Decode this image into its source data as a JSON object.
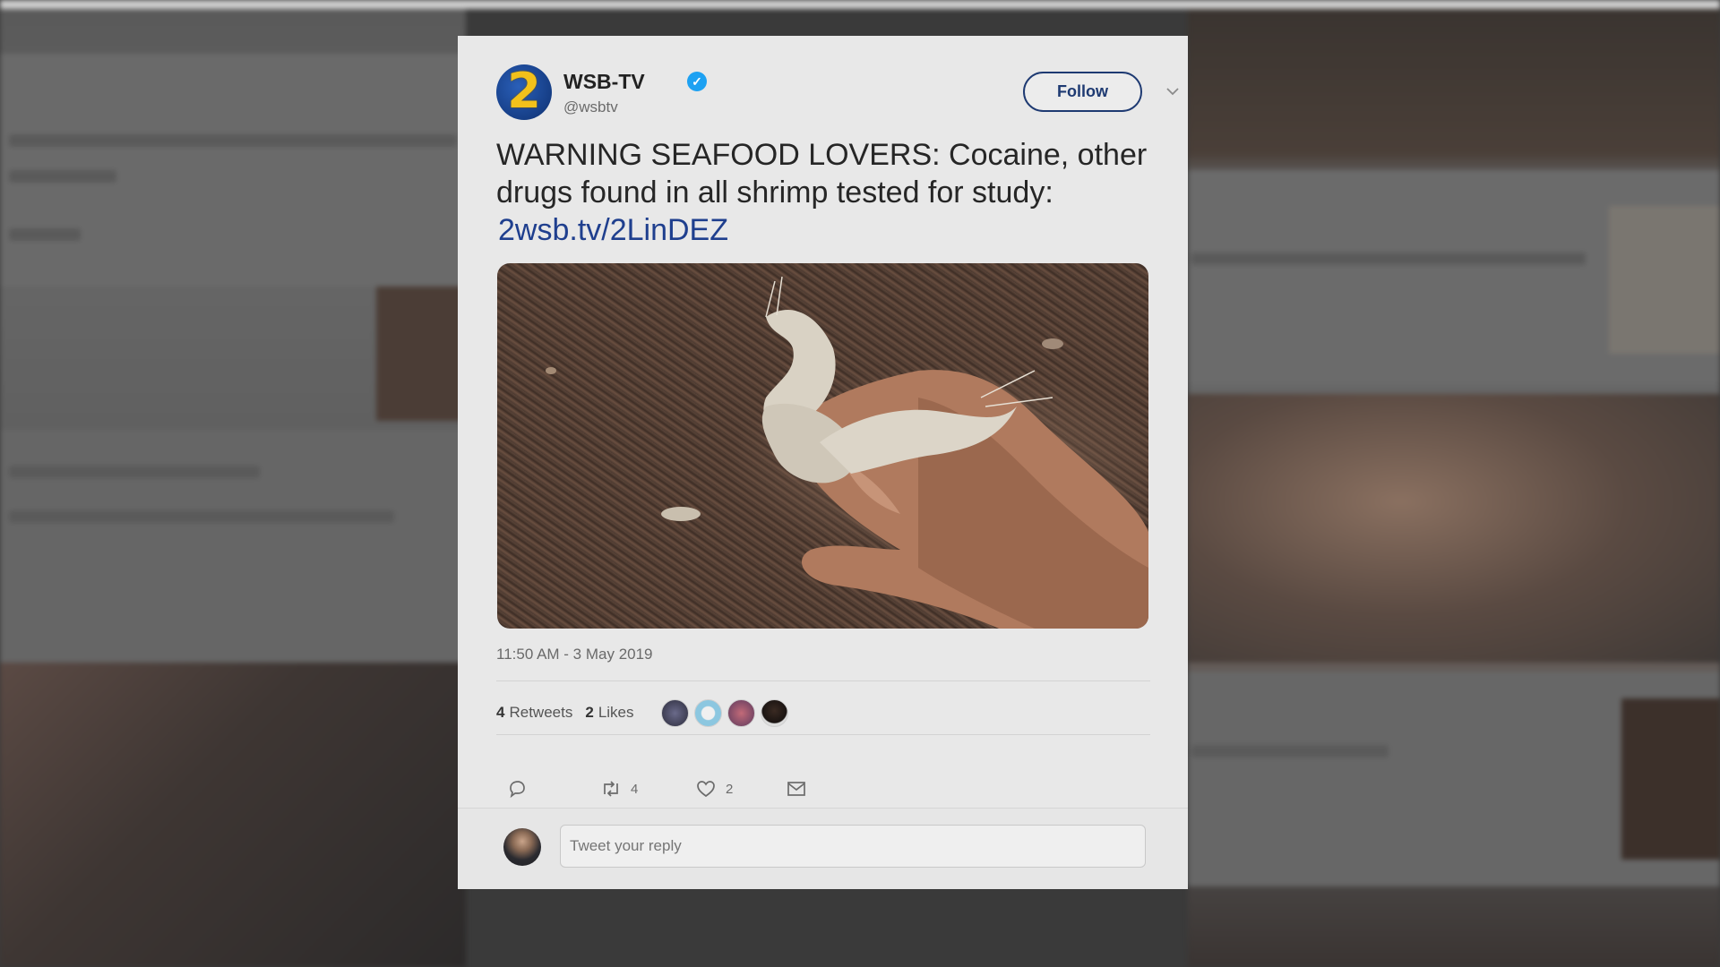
{
  "tweet": {
    "account": {
      "avatar_text": "2",
      "name": "WSB-TV",
      "verified_mark": "✓",
      "handle": "@wsbtv"
    },
    "follow_label": "Follow",
    "menu_caret": "⌄",
    "text": "WARNING SEAFOOD LOVERS: Cocaine, other drugs found in all shrimp tested for study:",
    "link": "2wsb.tv/2LinDEZ",
    "timestamp": "11:50 AM - 3 May 2019",
    "stats": {
      "retweets_count": "4",
      "retweets_label": "Retweets",
      "likes_count": "2",
      "likes_label": "Likes"
    },
    "actions": {
      "retweet_count": "4",
      "like_count": "2"
    },
    "reply": {
      "placeholder": "Tweet your reply"
    }
  },
  "colors": {
    "card_bg": "#e8e8e8",
    "follow_border": "#1e3a72",
    "link": "#1f3f8e",
    "verified": "#1da1f2",
    "avatar_bg": "#163e86",
    "avatar_digit": "#f2c11b"
  },
  "icons": [
    "verified-badge-icon",
    "chevron-down-icon",
    "reply-icon",
    "retweet-icon",
    "heart-icon",
    "mail-icon"
  ]
}
